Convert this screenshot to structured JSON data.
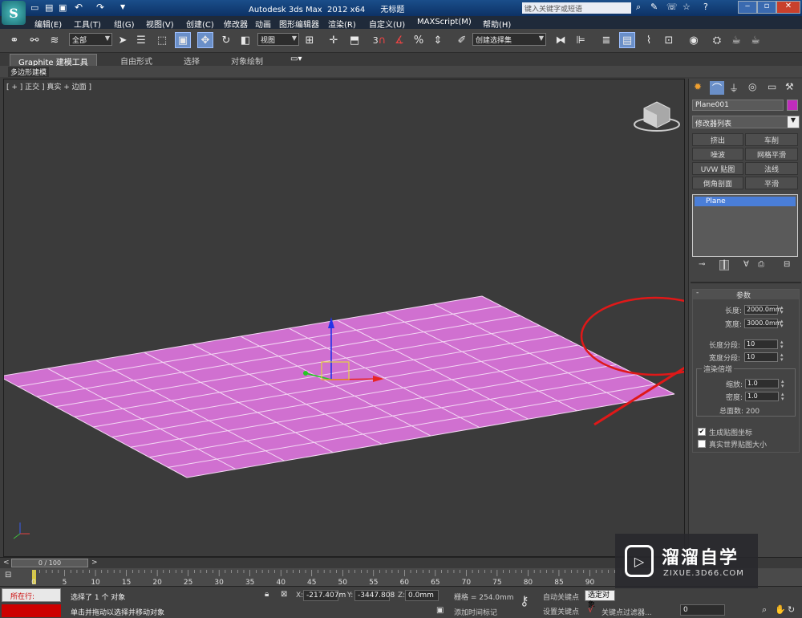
{
  "window": {
    "title": "Autodesk 3ds Max  2012 x64      无标题",
    "search_placeholder": "键入关键字或短语"
  },
  "menu": [
    "编辑(E)",
    "工具(T)",
    "组(G)",
    "视图(V)",
    "创建(C)",
    "修改器",
    "动画",
    "图形编辑器",
    "渲染(R)",
    "自定义(U)",
    "MAXScript(M)",
    "帮助(H)"
  ],
  "toolbar": {
    "selection_filter": "全部",
    "reference_coord": "视图",
    "snap_label": "3",
    "named_selection": "创建选择集"
  },
  "ribbon": {
    "tabs": [
      "Graphite 建模工具",
      "自由形式",
      "选择",
      "对象绘制"
    ],
    "sub_label": "多边形建模"
  },
  "viewport": {
    "label": "[ + ] 正交 ] 真实 + 边面 ]",
    "grid": {
      "rows": 10,
      "cols": 10
    },
    "mesh_color": "#d070d0",
    "edge_color": "#f4d8f4"
  },
  "command_panel": {
    "tab_icons": [
      "create-icon",
      "modify-icon",
      "hierarchy-icon",
      "motion-icon",
      "display-icon",
      "utilities-icon"
    ],
    "object_name": "Plane001",
    "object_color": "#c02cbc",
    "modifier_list": "修改器列表",
    "modifier_buttons": [
      "挤出",
      "车削",
      "噪波",
      "网格平滑",
      "UVW 贴图",
      "法线",
      "倒角剖面",
      "平滑"
    ],
    "stack_items": [
      "Plane"
    ],
    "params_title": "参数",
    "length_label": "长度:",
    "length_value": "2000.0mm",
    "width_label": "宽度:",
    "width_value": "3000.0mm",
    "length_segs_label": "长度分段:",
    "length_segs_value": "10",
    "width_segs_label": "宽度分段:",
    "width_segs_value": "10",
    "render_mult_label": "渲染倍增",
    "scale_label": "缩放:",
    "scale_value": "1.0",
    "density_label": "密度:",
    "density_value": "1.0",
    "total_faces_label": "总面数: 200",
    "gen_map_coords_label": "生成贴图坐标",
    "gen_map_coords_checked": true,
    "real_world_label": "真实世界贴图大小",
    "real_world_checked": false
  },
  "timeline": {
    "frame_label": "0 / 100",
    "current_frame": 0,
    "total_frames": 100,
    "ticks": [
      "0",
      "5",
      "10",
      "15",
      "20",
      "25",
      "30",
      "35",
      "40",
      "45",
      "50",
      "55",
      "60",
      "65",
      "70",
      "75",
      "80",
      "85",
      "90"
    ]
  },
  "status": {
    "maxscript_label": "所在行:",
    "selected_text": "选择了 1 个 对象",
    "prompt_text": "单击并拖动以选择并移动对象",
    "x_label": "X:",
    "x_value": "-217.407m",
    "y_label": "Y:",
    "y_value": "-3447.808",
    "z_label": "Z:",
    "z_value": "0.0mm",
    "grid_text": "栅格 = 254.0mm",
    "add_time_tag": "添加时间标记",
    "autokey_label": "自动关键点",
    "selected_object": "选定对象",
    "set_key_label": "设置关键点",
    "key_filters": "关键点过滤器...",
    "frame_field": "0"
  },
  "watermark": {
    "title": "溜溜自学",
    "url": "ZIXUE.3D66.COM"
  },
  "annotation_color": "#e01818"
}
